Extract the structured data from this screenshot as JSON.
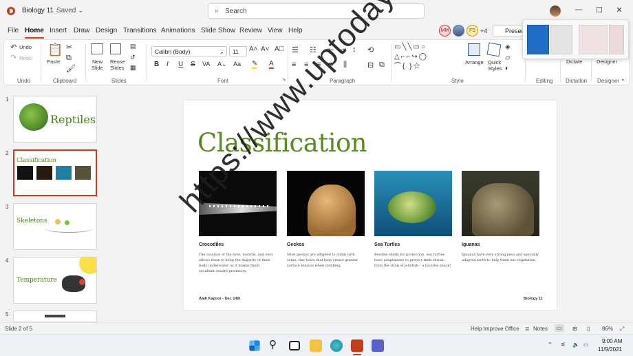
{
  "title_bar": {
    "doc_name": "Biology 11",
    "save_state": "Saved ⌄",
    "search_placeholder": "Search",
    "window_controls": [
      "—",
      "☐",
      "✕"
    ]
  },
  "menu": {
    "tabs": [
      "File",
      "Home",
      "Insert",
      "Draw",
      "Design",
      "Transitions",
      "Animations",
      "Slide Show",
      "Review",
      "View",
      "Help"
    ],
    "active": "Home",
    "collaborators": [
      "MM",
      "FS"
    ],
    "more_collaborators": "+4",
    "present_label": "Presen"
  },
  "ribbon": {
    "undo_label": "Undo",
    "redo_label": "Redo",
    "paste_label": "Paste",
    "new_slide_label_1": "New",
    "new_slide_label_2": "Slide",
    "reuse_slides_label_1": "Reuse",
    "reuse_slides_label_2": "Slides",
    "font_name": "Calibri (Body)",
    "font_size": "11",
    "arrange_label": "Arrange",
    "quick_styles_label_1": "Quick",
    "quick_styles_label_2": "Styles",
    "dictate_label": "Dictate",
    "designer_label": "Designer",
    "groups": [
      "Undo",
      "Clipboard",
      "Slides",
      "Font",
      "Paragraph",
      "Style",
      "Editing",
      "Dictation",
      "Designer"
    ],
    "bold": "B",
    "italic": "I",
    "underline": "U",
    "strike": "S"
  },
  "slides_panel": {
    "numbers": [
      "1",
      "2",
      "3",
      "4",
      "5"
    ],
    "titles": [
      "Reptiles",
      "Classification",
      "Skeletons",
      "Temperature"
    ]
  },
  "slide": {
    "title": "Classification",
    "cards": [
      {
        "name": "Crocodiles",
        "text": "The location of the eyes, nostrils, and ears allows them to keep the majority of their body underwater as it makes them excellent stealth predators."
      },
      {
        "name": "Geckos",
        "text": "Most geckos are adapted to climb with setae, tiny hairs that help create greater surface tension when climbing."
      },
      {
        "name": "Sea Turtles",
        "text": "Besides shells for protection, sea turtles have adaptations to protect their throat from the sting of jellyfish – a favorite snack!"
      },
      {
        "name": "Iguanas",
        "text": "Iguanas have very strong jaws and specially adapted teeth to help them eat vegetation."
      }
    ],
    "footer_left": "Aadi Kapoor - Dec 14th",
    "footer_right": "Biology 11"
  },
  "status_bar": {
    "slide_count": "Slide 2 of 5",
    "help_improve": "Help Improve Office",
    "notes": "Notes",
    "zoom": "86%"
  },
  "taskbar": {
    "time": "9:00 AM",
    "date": "11/9/2021"
  },
  "watermark": "https://www.uptodays.ir",
  "colors": {
    "accent": "#c43e1c",
    "title_green": "#5a8a21"
  }
}
